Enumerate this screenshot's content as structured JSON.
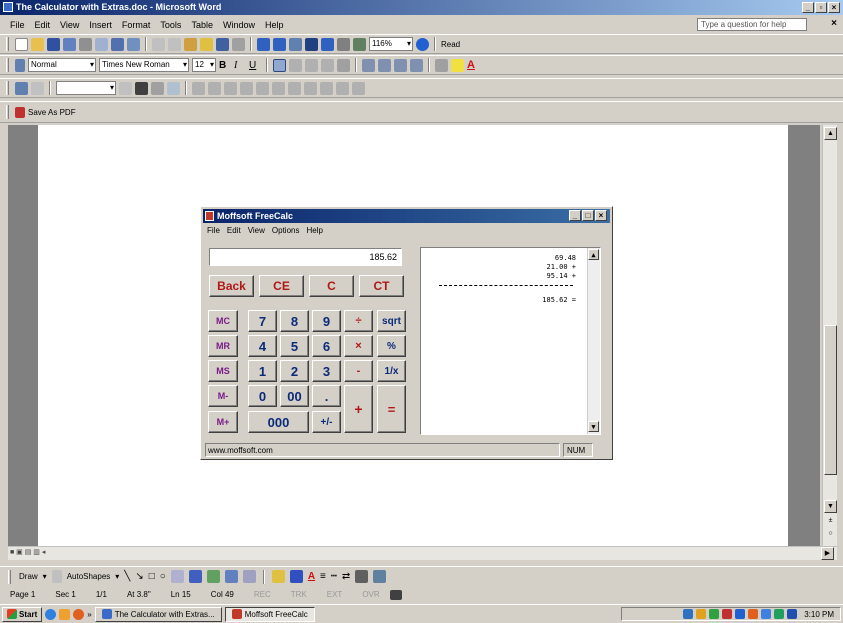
{
  "word": {
    "title": "The Calculator with Extras.doc - Microsoft Word",
    "menu": [
      "File",
      "Edit",
      "View",
      "Insert",
      "Format",
      "Tools",
      "Table",
      "Window",
      "Help"
    ],
    "help_placeholder": "Type a question for help",
    "zoom": "116%",
    "read_label": "Read",
    "style": "Normal",
    "font": "Times New Roman",
    "font_size": "12",
    "save_pdf_label": "Save As PDF"
  },
  "calc": {
    "title": "Moffsoft FreeCalc",
    "menu": [
      "File",
      "Edit",
      "View",
      "Options",
      "Help"
    ],
    "display": "185.62",
    "tape": [
      "69.48",
      "21.00 +",
      "95.14 +",
      "185.62 ="
    ],
    "buttons": {
      "back": "Back",
      "ce": "CE",
      "c": "C",
      "ct": "CT",
      "mc": "MC",
      "mr": "MR",
      "ms": "MS",
      "mminus": "M-",
      "mplus": "M+",
      "n7": "7",
      "n8": "8",
      "n9": "9",
      "n4": "4",
      "n5": "5",
      "n6": "6",
      "n1": "1",
      "n2": "2",
      "n3": "3",
      "n0": "0",
      "n00": "00",
      "n000": "000",
      "dot": ".",
      "sign": "+/-",
      "div": "÷",
      "mul": "×",
      "sub": "-",
      "add": "+",
      "eq": "=",
      "sqrt": "sqrt",
      "pct": "%",
      "recip": "1/x"
    },
    "status_url": "www.moffsoft.com",
    "status_num": "NUM"
  },
  "drawbar": {
    "draw": "Draw",
    "autoshapes": "AutoShapes"
  },
  "statusbar": {
    "page": "Page 1",
    "sec": "Sec 1",
    "pages": "1/1",
    "at": "At 3.8\"",
    "ln": "Ln 15",
    "col": "Col 49",
    "rec": "REC",
    "trk": "TRK",
    "ext": "EXT",
    "ovr": "OVR"
  },
  "taskbar": {
    "start": "Start",
    "task1": "The Calculator with Extras...",
    "task2": "Moffsoft FreeCalc",
    "clock": "3:10 PM"
  }
}
